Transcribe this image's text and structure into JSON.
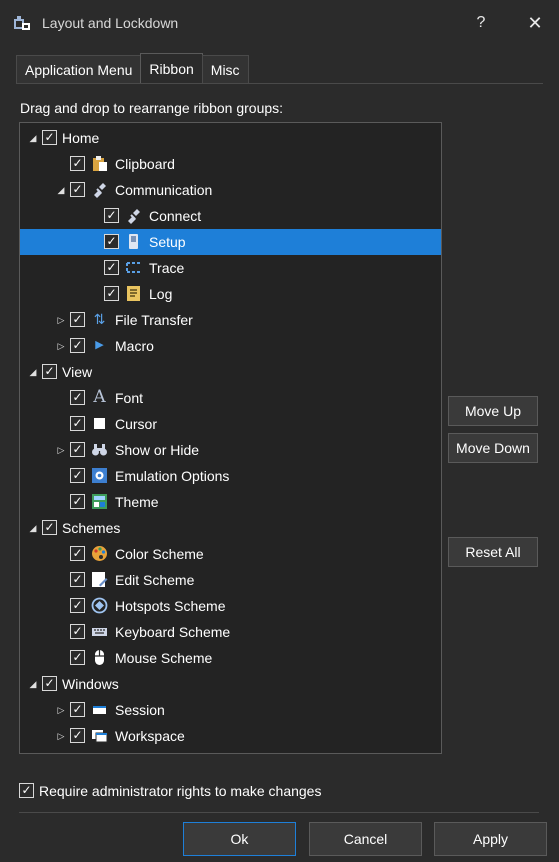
{
  "window": {
    "title": "Layout and Lockdown",
    "help_label": "?",
    "close_label": "✕"
  },
  "tabs": [
    {
      "label": "Application Menu",
      "active": false
    },
    {
      "label": "Ribbon",
      "active": true
    },
    {
      "label": "Misc",
      "active": false
    }
  ],
  "instruction": "Drag and drop to rearrange ribbon groups:",
  "tree": [
    {
      "label": "Home",
      "checked": true,
      "expanded": true,
      "selected": false,
      "icon": ""
    },
    {
      "label": "Clipboard",
      "checked": true,
      "selected": false,
      "icon": "clipboard-icon"
    },
    {
      "label": "Communication",
      "checked": true,
      "expanded": true,
      "selected": false,
      "icon": "plug-icon"
    },
    {
      "label": "Connect",
      "checked": true,
      "selected": false,
      "icon": "plug-icon"
    },
    {
      "label": "Setup",
      "checked": true,
      "selected": true,
      "icon": "phone-icon"
    },
    {
      "label": "Trace",
      "checked": true,
      "selected": false,
      "icon": "trace-icon"
    },
    {
      "label": "Log",
      "checked": true,
      "selected": false,
      "icon": "log-icon"
    },
    {
      "label": "File Transfer",
      "checked": true,
      "expanded": false,
      "selected": false,
      "icon": "transfer-icon"
    },
    {
      "label": "Macro",
      "checked": true,
      "expanded": false,
      "selected": false,
      "icon": "play-icon"
    },
    {
      "label": "View",
      "checked": true,
      "expanded": true,
      "selected": false,
      "icon": ""
    },
    {
      "label": "Font",
      "checked": true,
      "selected": false,
      "icon": "font-icon"
    },
    {
      "label": "Cursor",
      "checked": true,
      "selected": false,
      "icon": "cursor-icon"
    },
    {
      "label": "Show or Hide",
      "checked": true,
      "expanded": false,
      "selected": false,
      "icon": "binoculars-icon"
    },
    {
      "label": "Emulation Options",
      "checked": true,
      "selected": false,
      "icon": "emulation-icon"
    },
    {
      "label": "Theme",
      "checked": true,
      "selected": false,
      "icon": "theme-icon"
    },
    {
      "label": "Schemes",
      "checked": true,
      "expanded": true,
      "selected": false,
      "icon": ""
    },
    {
      "label": "Color Scheme",
      "checked": true,
      "selected": false,
      "icon": "palette-icon"
    },
    {
      "label": "Edit Scheme",
      "checked": true,
      "selected": false,
      "icon": "edit-icon"
    },
    {
      "label": "Hotspots Scheme",
      "checked": true,
      "selected": false,
      "icon": "hotspot-icon"
    },
    {
      "label": "Keyboard Scheme",
      "checked": true,
      "selected": false,
      "icon": "keyboard-icon"
    },
    {
      "label": "Mouse Scheme",
      "checked": true,
      "selected": false,
      "icon": "mouse-icon"
    },
    {
      "label": "Windows",
      "checked": true,
      "expanded": true,
      "selected": false,
      "icon": ""
    },
    {
      "label": "Session",
      "checked": true,
      "expanded": false,
      "selected": false,
      "icon": "session-icon"
    },
    {
      "label": "Workspace",
      "checked": true,
      "expanded": false,
      "selected": false,
      "icon": "workspace-icon"
    }
  ],
  "side_buttons": {
    "move_up": "Move Up",
    "move_down": "Move Down",
    "reset_all": "Reset All"
  },
  "admin": {
    "label": "Require administrator rights to make changes",
    "checked": true
  },
  "footer": {
    "ok": "Ok",
    "cancel": "Cancel",
    "apply": "Apply"
  },
  "colors": {
    "background": "#2b2b2b",
    "selection": "#1e7fd8",
    "text": "#ffffff"
  }
}
